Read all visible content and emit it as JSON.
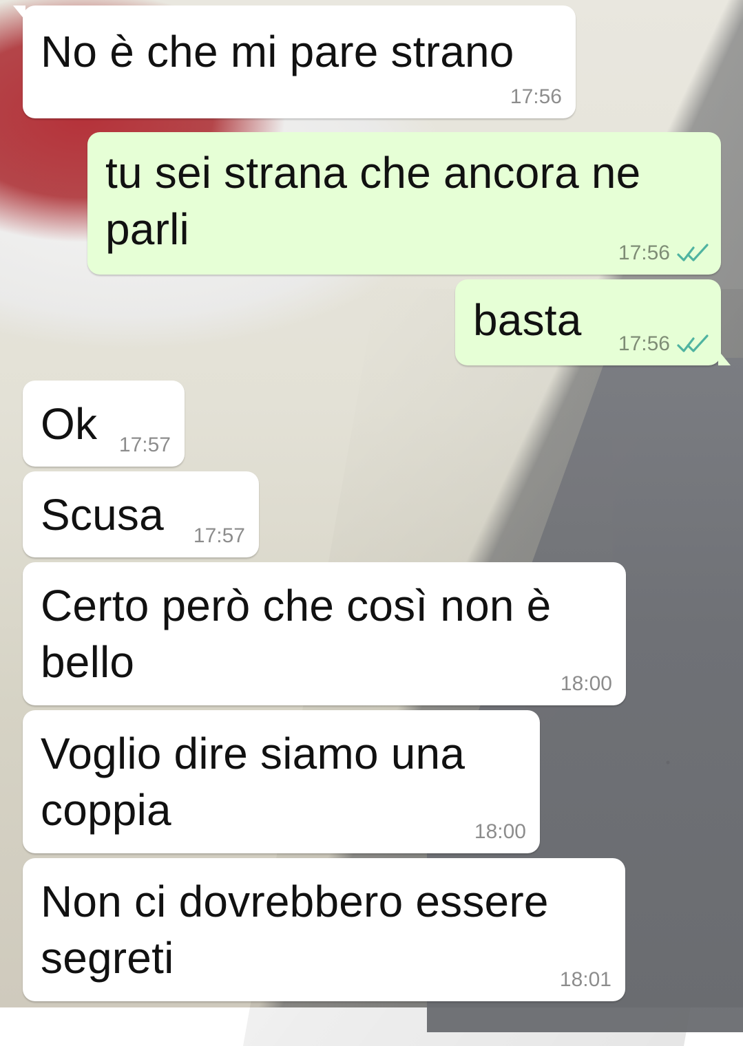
{
  "theme": {
    "incoming_bg": "#ffffff",
    "outgoing_bg": "#e6ffd6",
    "text_color": "#111111",
    "time_color": "#8a8a8a",
    "tick_color": "#4fb3a0"
  },
  "messages": [
    {
      "id": "m1",
      "direction": "in",
      "text": "No è che mi pare strano",
      "time": "17:56",
      "read_ticks": false
    },
    {
      "id": "m2",
      "direction": "out",
      "text": "tu sei strana che ancora ne\nparli",
      "time": "17:56",
      "read_ticks": true
    },
    {
      "id": "m3",
      "direction": "out",
      "text": "basta",
      "time": "17:56",
      "read_ticks": true
    },
    {
      "id": "m4",
      "direction": "in",
      "text": "Ok",
      "time": "17:57",
      "read_ticks": false
    },
    {
      "id": "m5",
      "direction": "in",
      "text": "Scusa",
      "time": "17:57",
      "read_ticks": false
    },
    {
      "id": "m6",
      "direction": "in",
      "text": "Certo però che così non è\nbello",
      "time": "18:00",
      "read_ticks": false
    },
    {
      "id": "m7",
      "direction": "in",
      "text": "Voglio dire siamo una\ncoppia",
      "time": "18:00",
      "read_ticks": false
    },
    {
      "id": "m8",
      "direction": "in",
      "text": "Non ci dovrebbero essere\nsegreti",
      "time": "18:01",
      "read_ticks": false
    }
  ],
  "icons": {
    "double_check": "double-check-icon"
  }
}
